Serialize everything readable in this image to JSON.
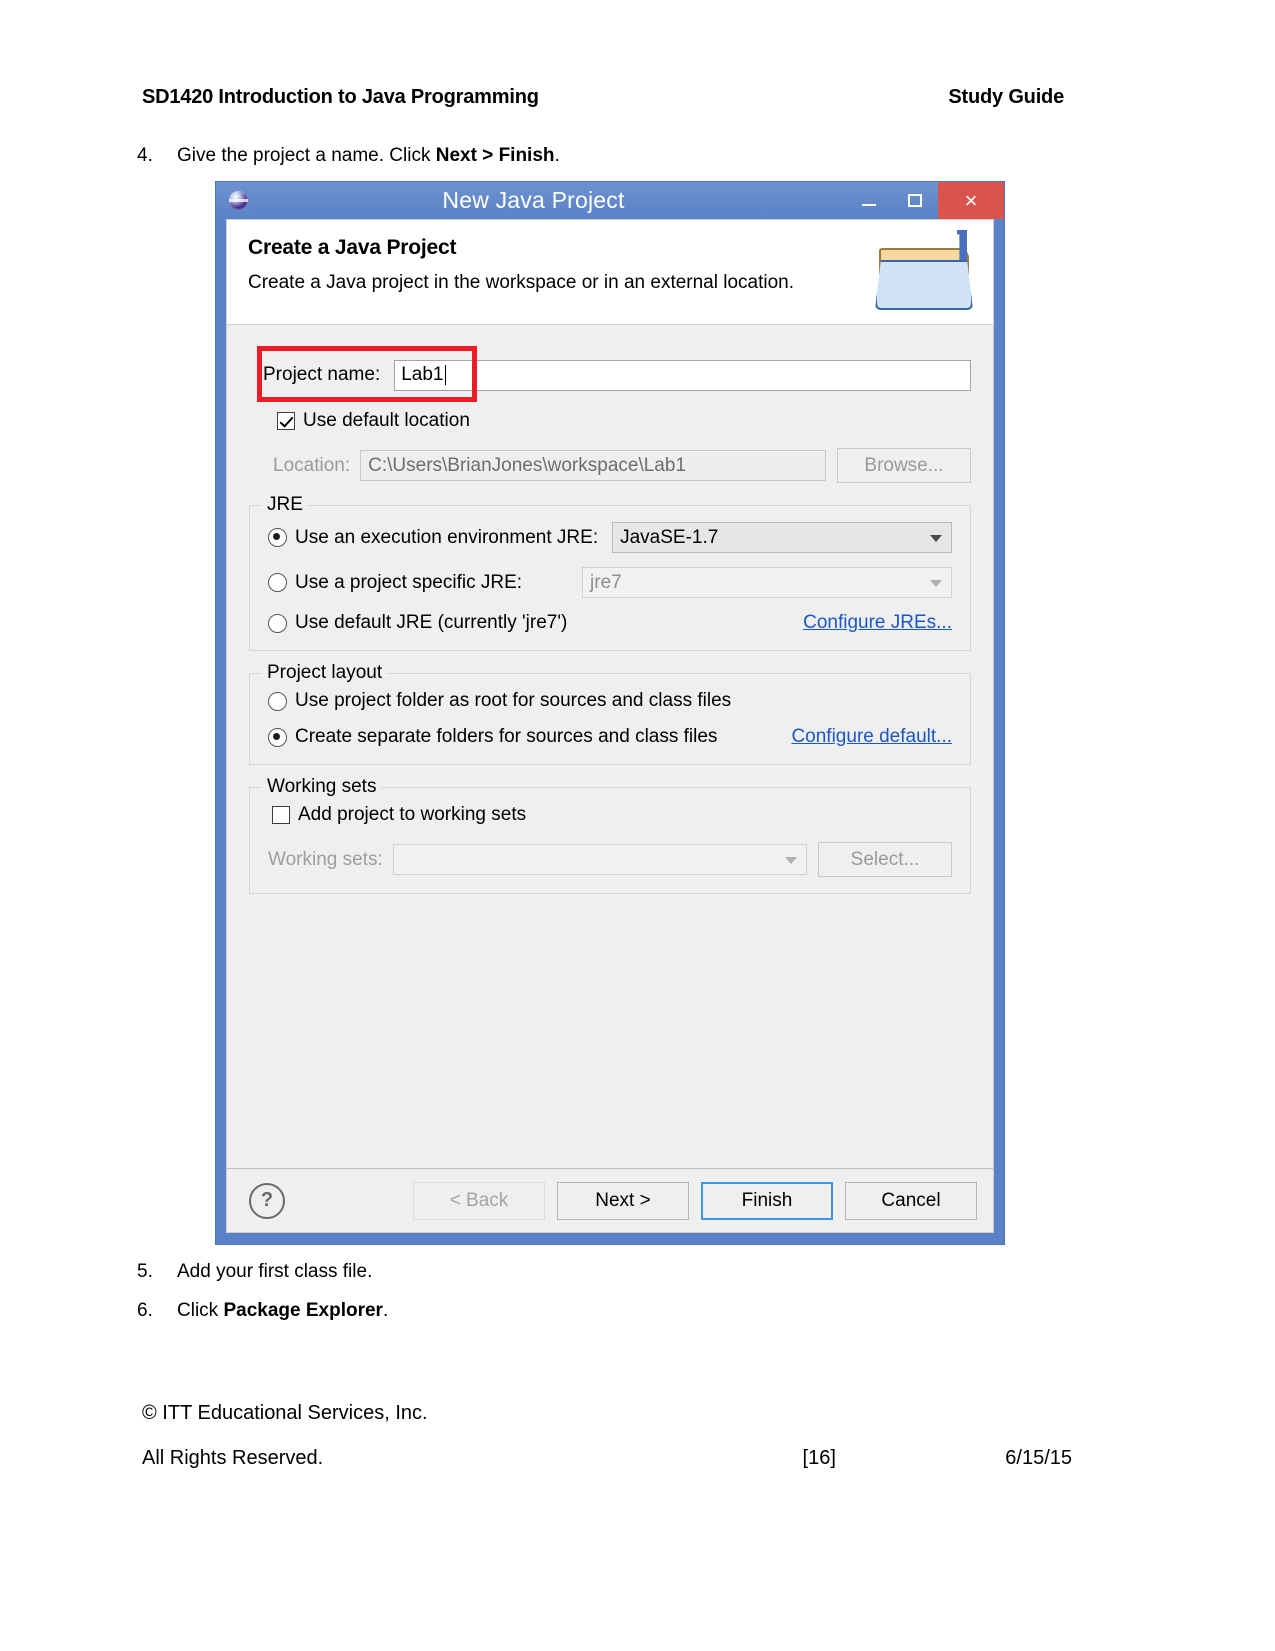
{
  "document": {
    "header_left": "SD1420 Introduction to Java Programming",
    "header_right": "Study Guide",
    "steps": [
      {
        "num": "4.",
        "pre": "Give the project a name. Click ",
        "bold1": "Next",
        "mid": " > ",
        "bold2": "Finish",
        "post": "."
      },
      {
        "num": "5.",
        "text": "Add your first class file."
      },
      {
        "num": "6.",
        "pre": "Click ",
        "bold": "Package Explorer",
        "post": "."
      }
    ],
    "footer": {
      "copyright": "© ITT Educational Services, Inc.",
      "rights": "All Rights Reserved.",
      "page_number": "[16]",
      "date": "6/15/15"
    }
  },
  "dialog": {
    "title": "New Java Project",
    "title_icon": "eclipse-globe-icon",
    "window_buttons": {
      "minimize": "–",
      "maximize": "□",
      "close": "×"
    },
    "header": {
      "heading": "Create a Java Project",
      "subtext": "Create a Java project in the workspace or in an external location.",
      "icon": "java-project-folder-icon"
    },
    "project_name": {
      "label": "Project name:",
      "value": "Lab1",
      "placeholder": ""
    },
    "use_default_location": {
      "label": "Use default location",
      "checked": true
    },
    "location": {
      "label": "Location:",
      "value": "C:\\Users\\BrianJones\\workspace\\Lab1",
      "browse_label": "Browse..."
    },
    "jre": {
      "legend": "JRE",
      "options": [
        {
          "label": "Use an execution environment JRE:",
          "selected": true,
          "combo_value": "JavaSE-1.7",
          "combo_disabled": false
        },
        {
          "label": "Use a project specific JRE:",
          "selected": false,
          "combo_value": "jre7",
          "combo_disabled": true
        },
        {
          "label": "Use default JRE (currently 'jre7')",
          "selected": false
        }
      ],
      "link": "Configure JREs..."
    },
    "project_layout": {
      "legend": "Project layout",
      "options": [
        {
          "label": "Use project folder as root for sources and class files",
          "selected": false
        },
        {
          "label": "Create separate folders for sources and class files",
          "selected": true
        }
      ],
      "link": "Configure default..."
    },
    "working_sets": {
      "legend": "Working sets",
      "checkbox_label": "Add project to working sets",
      "checked": false,
      "label": "Working sets:",
      "value": "",
      "select_label": "Select..."
    },
    "buttons": {
      "help": "?",
      "back": "< Back",
      "next": "Next >",
      "finish": "Finish",
      "cancel": "Cancel"
    },
    "colors": {
      "titlebar": "#5b82c8",
      "close": "#d9544d",
      "focus_border": "#3d97e8",
      "link": "#1a57c8",
      "highlight_box": "#ee1c25"
    }
  }
}
